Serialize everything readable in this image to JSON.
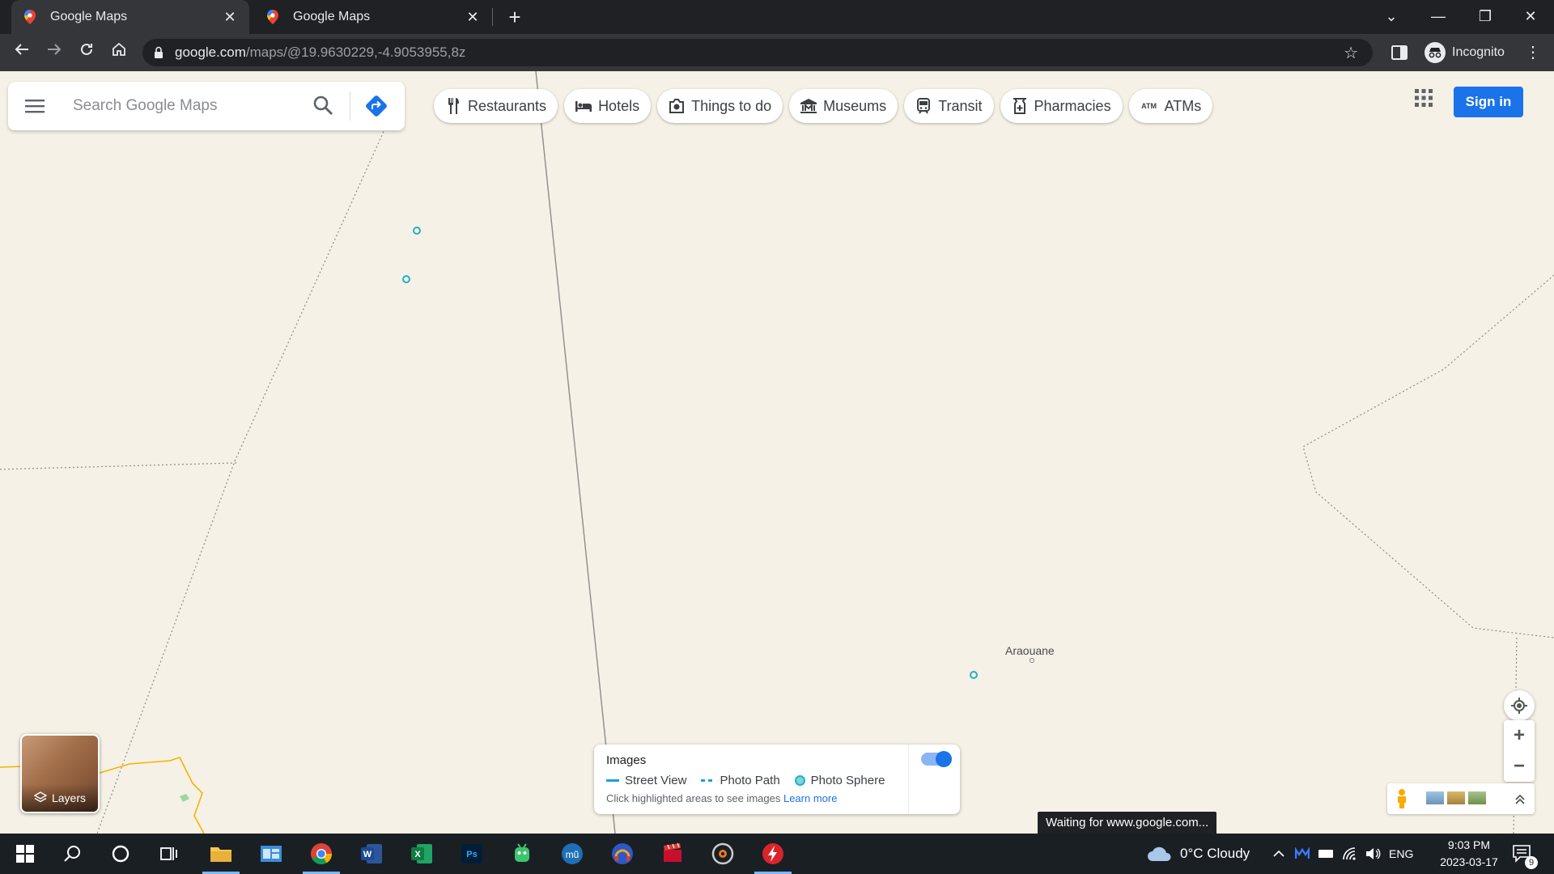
{
  "browser": {
    "tabs": [
      {
        "title": "Google Maps",
        "icon": "google-maps-pin-icon",
        "active": true
      },
      {
        "title": "Google Maps",
        "icon": "google-maps-pin-icon",
        "active": false
      }
    ],
    "url_host": "google.com",
    "url_path": "/maps/@19.9630229,-4.9053955,8z",
    "profile_label": "Incognito"
  },
  "maps": {
    "search_placeholder": "Search Google Maps",
    "chips": [
      {
        "label": "Restaurants",
        "icon": "fork-knife-icon"
      },
      {
        "label": "Hotels",
        "icon": "bed-icon"
      },
      {
        "label": "Things to do",
        "icon": "camera-icon"
      },
      {
        "label": "Museums",
        "icon": "museum-icon"
      },
      {
        "label": "Transit",
        "icon": "train-icon"
      },
      {
        "label": "Pharmacies",
        "icon": "pharmacy-icon"
      },
      {
        "label": "ATMs",
        "icon": "atm-icon"
      }
    ],
    "sign_in": "Sign in",
    "place_label": "Araouane",
    "layers_label": "Layers",
    "images_panel": {
      "title": "Images",
      "legend": [
        "Street View",
        "Photo Path",
        "Photo Sphere"
      ],
      "hint": "Click highlighted areas to see images",
      "learn_more": "Learn more",
      "toggle_on": true
    },
    "status_text": "Waiting for www.google.com...",
    "colors": {
      "accent": "#1a73e8",
      "map_bg": "#f5f1e6",
      "photo_sphere": "#1eb3c7"
    }
  },
  "taskbar": {
    "weather": "0°C  Cloudy",
    "language": "ENG",
    "time": "9:03 PM",
    "date": "2023-03-17",
    "notifications": "9"
  }
}
